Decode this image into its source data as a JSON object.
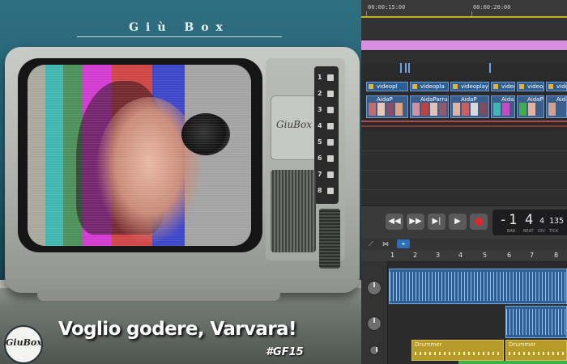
{
  "artwork": {
    "title": "Giù Box",
    "caption": "Voglio godere, Varvara!",
    "hashtag": "#GF15",
    "logo_text": "GiuBox",
    "tv_plate_text": "GiuBox",
    "channel_buttons": [
      "1",
      "2",
      "3",
      "4",
      "5",
      "6",
      "7",
      "8"
    ]
  },
  "daw": {
    "ruler": {
      "timecodes": [
        "00:00:15:00",
        "00:00:20:00"
      ]
    },
    "video_clips": [
      "videopl",
      "videopla",
      "videoplay",
      "videopl",
      "videopl",
      "video"
    ],
    "thumbnail_clips": [
      "AidaP",
      "AidaParruc",
      "AidaP",
      "Aida",
      "AidaP",
      "Aida"
    ],
    "transport": {
      "rewind": "◀◀",
      "forward": "▶▶",
      "to_start": "▶|",
      "play": "▶"
    },
    "lcd": {
      "prefix": "-",
      "bar": "1",
      "beat": "4",
      "div": "4",
      "tick": "135",
      "labels": [
        "BAR",
        "BEAT",
        "DIV",
        "TICK"
      ]
    },
    "bar_numbers": [
      "1",
      "2",
      "3",
      "4",
      "5",
      "6",
      "7",
      "8"
    ],
    "drummer_clips": [
      "Drummer",
      "Drummer"
    ]
  },
  "colors": {
    "region_blue": "#2f5f92",
    "drummer_yellow": "#b69a2a",
    "marker_pink": "#d98ee0",
    "record_red": "#e0262c",
    "playhead_yellow": "#c7b21c"
  },
  "icons": {
    "rewind": "rewind-icon",
    "forward": "fast-forward-icon",
    "to_start": "skip-icon",
    "play": "play-icon",
    "record": "record-icon"
  }
}
